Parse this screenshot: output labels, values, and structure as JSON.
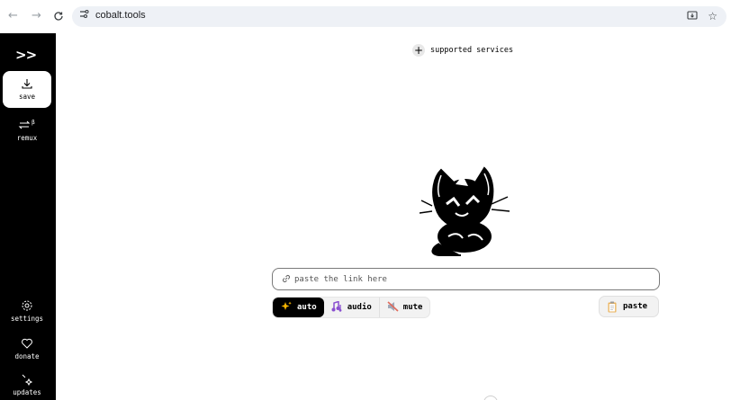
{
  "browser": {
    "back_icon": "←",
    "forward_icon": "→",
    "reload_icon": "C",
    "site_settings_icon": "⇆",
    "url": "cobalt.tools",
    "install_icon": "⊡",
    "bookmark_icon": "☆"
  },
  "sidebar": {
    "logo": ">>",
    "items": [
      {
        "label": "save",
        "icon": "download-icon"
      },
      {
        "label": "remux",
        "icon": "remux-icon",
        "badge": "β"
      },
      {
        "label": "settings",
        "icon": "gear-icon"
      },
      {
        "label": "donate",
        "icon": "heart-icon"
      },
      {
        "label": "updates",
        "icon": "sparkle-icon"
      }
    ]
  },
  "main": {
    "supported_services": "supported services",
    "link_placeholder": "paste the link here",
    "link_value": "",
    "modes": [
      {
        "label": "auto",
        "emoji": "✨",
        "active": true
      },
      {
        "label": "audio",
        "emoji": "🎶",
        "active": false
      },
      {
        "label": "mute",
        "emoji": "🔇",
        "active": false
      }
    ],
    "paste_label": "paste"
  },
  "colors": {
    "sidebar_bg": "#000000",
    "main_bg": "#ffffff",
    "omnibox_bg": "#eef1f6",
    "active_mode_bg": "#000000",
    "button_bg": "#f2f2f2"
  }
}
